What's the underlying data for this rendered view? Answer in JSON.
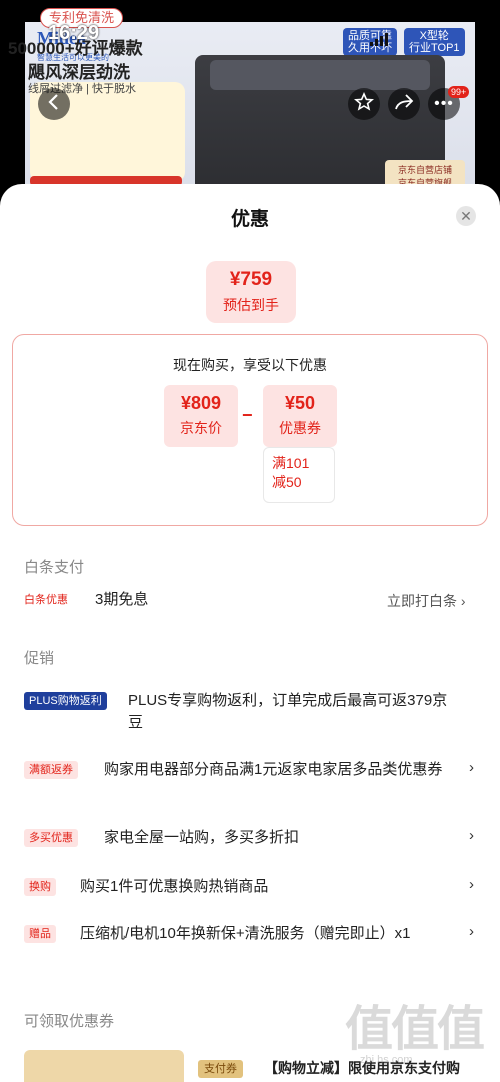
{
  "status": {
    "time": "16:29"
  },
  "hero": {
    "brand": "Midea",
    "brand_sub": "智慧生活可以更美的",
    "badge_left": "品质可靠\n久用不坏",
    "badge_right": "X型轮\n行业TOP1",
    "promo_tag": "专利免清洗",
    "promo_line1": "500000+好评爆款",
    "promo_line2": "飓风深层劲洗",
    "promo_line3": "线屑过滤净 | 快于脱水",
    "store_tag": "京东自营店铺\n京东自营旗舰",
    "cart_badge": "99+"
  },
  "sheet": {
    "title": "优惠",
    "estimate": {
      "price": "¥759",
      "label": "预估到手"
    },
    "calc": {
      "heading": "现在购买，享受以下优惠",
      "base": {
        "value": "¥809",
        "label": "京东价"
      },
      "operator": "−",
      "coupon": {
        "value": "¥50",
        "label": "优惠券"
      },
      "coupon_condition": [
        "满101",
        "减50"
      ]
    },
    "baitiao": {
      "section_title": "白条支付",
      "tag": "白条优惠",
      "text": "3期免息",
      "link": "立即打白条 ›"
    },
    "promotions": {
      "section_title": "促销",
      "items": [
        {
          "tag": "PLUS购物返利",
          "text": "PLUS专享购物返利，订单完成后最高可返379京豆"
        },
        {
          "tag": "满额返券",
          "text": "购家用电器部分商品满1元返家电家居多品类优惠券"
        },
        {
          "tag": "多买优惠",
          "text": "家电全屋一站购，多买多折扣"
        },
        {
          "tag": "换购",
          "text": "购买1件可优惠换购热销商品"
        },
        {
          "tag": "赠品",
          "text": "压缩机/电机10年换新保+清洗服务（赠完即止）x1"
        }
      ]
    },
    "coupons": {
      "section_title": "可领取优惠券",
      "item_tag": "支付券",
      "item_text": "【购物立减】限使用京东支付购"
    },
    "watermark": "值值值",
    "watermark_sub": "zhi.hs.com"
  },
  "colors": {
    "accent": "#e2231a",
    "accent_bg": "#fde3e2",
    "plus": "#1f3f9c"
  },
  "icons": [
    "back-arrow-icon",
    "star-icon",
    "share-icon",
    "more-icon",
    "close-icon",
    "chevron-right-icon"
  ]
}
